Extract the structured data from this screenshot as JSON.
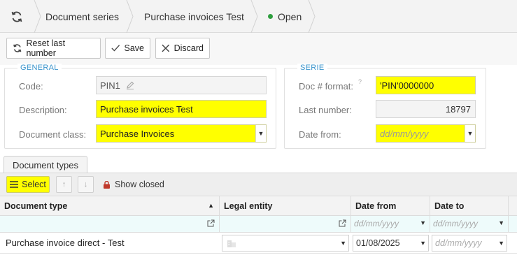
{
  "breadcrumb": {
    "items": [
      "Document series",
      "Purchase invoices Test"
    ],
    "status": "Open",
    "status_color": "#2e9e3e"
  },
  "toolbar": {
    "reset_label": "Reset last number",
    "save_label": "Save",
    "discard_label": "Discard"
  },
  "general": {
    "legend": "GENERAL",
    "code_label": "Code:",
    "code_value": "PIN1",
    "description_label": "Description:",
    "description_value": "Purchase invoices Test",
    "doc_class_label": "Document class:",
    "doc_class_value": "Purchase Invoices"
  },
  "serie": {
    "legend": "SERIE",
    "format_label": "Doc # format:",
    "format_help": "?",
    "format_value": "'PIN'0000000",
    "last_number_label": "Last number:",
    "last_number_value": "18797",
    "date_from_label": "Date from:",
    "date_from_placeholder": "dd/mm/yyyy"
  },
  "tabs": {
    "document_types": "Document types"
  },
  "subtoolbar": {
    "select_label": "Select",
    "show_closed_label": "Show closed"
  },
  "grid": {
    "columns": [
      "Document type",
      "Legal entity",
      "Date from",
      "Date to"
    ],
    "filter_placeholder": "dd/mm/yyyy",
    "rows": [
      {
        "document_type": "Purchase invoice direct - Test",
        "legal_entity": "",
        "date_from": "01/08/2025",
        "date_to_placeholder": "dd/mm/yyyy"
      }
    ]
  },
  "colors": {
    "highlight": "#ffff00",
    "legend": "#3a94cc"
  }
}
